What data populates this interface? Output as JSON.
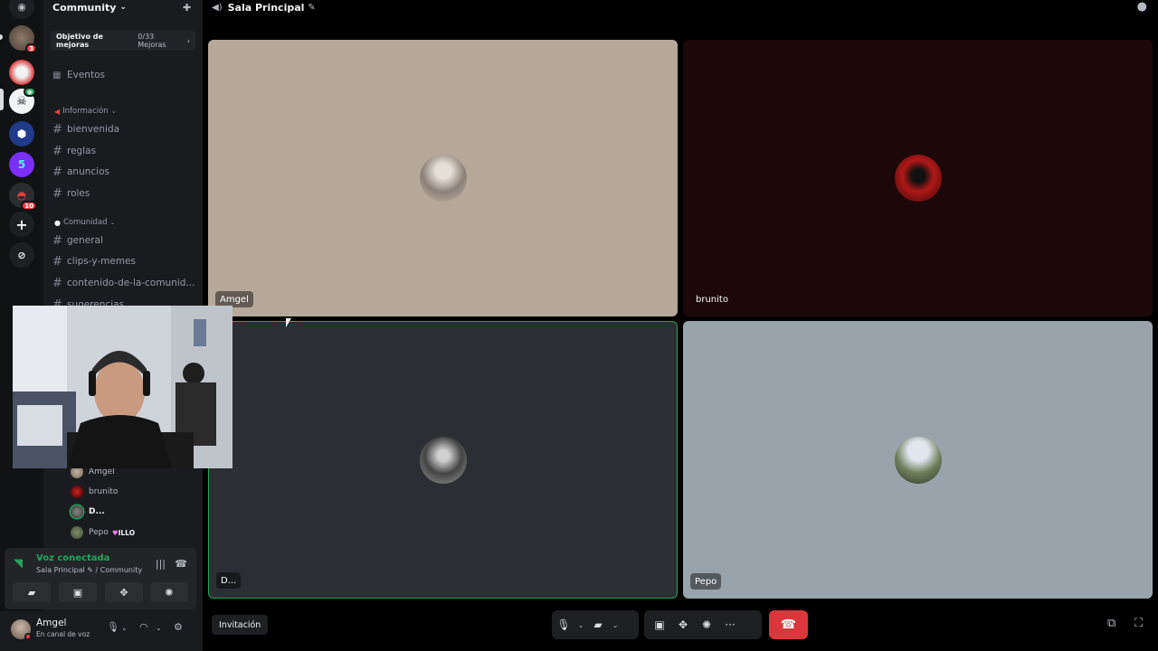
{
  "server": {
    "name": "Community"
  },
  "boost": {
    "goal_label": "Objetivo de mejoras",
    "count": "0/33 Mejoras"
  },
  "rail": {
    "badges": [
      "3",
      "10"
    ]
  },
  "channels": {
    "events": "Eventos",
    "info_category": "Información",
    "info": [
      "bienvenida",
      "reglas",
      "anuncios",
      "roles"
    ],
    "community_category": "Comunidad",
    "community": [
      "general",
      "clips-y-memes",
      "contenido-de-la-comunid...",
      "sugerencias"
    ]
  },
  "voice_members": [
    {
      "name": "Amgel"
    },
    {
      "name": "brunito"
    },
    {
      "name": "D..."
    },
    {
      "name": "Pepo",
      "tag": "ILLO"
    }
  ],
  "voice_panel": {
    "status": "Voz conectada",
    "location": "Sala Principal",
    "sep_server": "/ Community"
  },
  "user": {
    "name": "Amgel",
    "status": "En canal de voz"
  },
  "topbar": {
    "channel": "Sala Principal"
  },
  "tiles": [
    {
      "name": "Amgel",
      "bg": "#b6a89a"
    },
    {
      "name": "brunito",
      "bg": "#1c0808"
    },
    {
      "name": "D...",
      "bg": "#2b2f33"
    },
    {
      "name": "Pepo",
      "bg": "#99a3ac"
    }
  ],
  "controls": {
    "invite": "Invitación"
  },
  "colors": {
    "speaking": "#23a55a",
    "leave": "#da373c"
  }
}
